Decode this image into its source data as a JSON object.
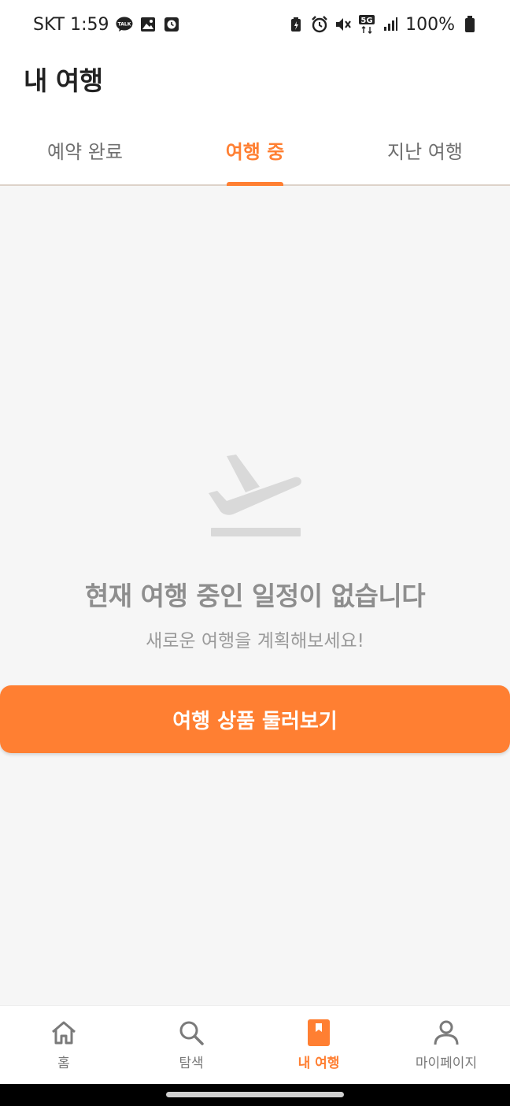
{
  "status_bar": {
    "carrier_time": "SKT 1:59",
    "network": "5G",
    "battery": "100%",
    "icons": [
      "kakaotalk-icon",
      "gallery-icon",
      "clock-icon",
      "battery-saver-icon",
      "alarm-icon",
      "mute-icon",
      "5g-icon",
      "signal-icon",
      "battery-icon"
    ]
  },
  "header": {
    "title": "내 여행"
  },
  "tabs": [
    {
      "label": "예약 완료",
      "active": false
    },
    {
      "label": "여행 중",
      "active": true
    },
    {
      "label": "지난 여행",
      "active": false
    }
  ],
  "empty_state": {
    "icon": "airplane-takeoff-icon",
    "title": "현재 여행 중인 일정이 없습니다",
    "subtitle": "새로운 여행을 계획해보세요!",
    "button_label": "여행 상품 둘러보기"
  },
  "bottom_nav": [
    {
      "label": "홈",
      "icon": "home-icon",
      "active": false
    },
    {
      "label": "탐색",
      "icon": "search-icon",
      "active": false
    },
    {
      "label": "내 여행",
      "icon": "bookmark-book-icon",
      "active": true
    },
    {
      "label": "마이페이지",
      "icon": "user-icon",
      "active": false
    }
  ],
  "colors": {
    "accent": "#ff7f32",
    "background": "#f6f6f6",
    "muted_text": "#8e8e8e"
  }
}
